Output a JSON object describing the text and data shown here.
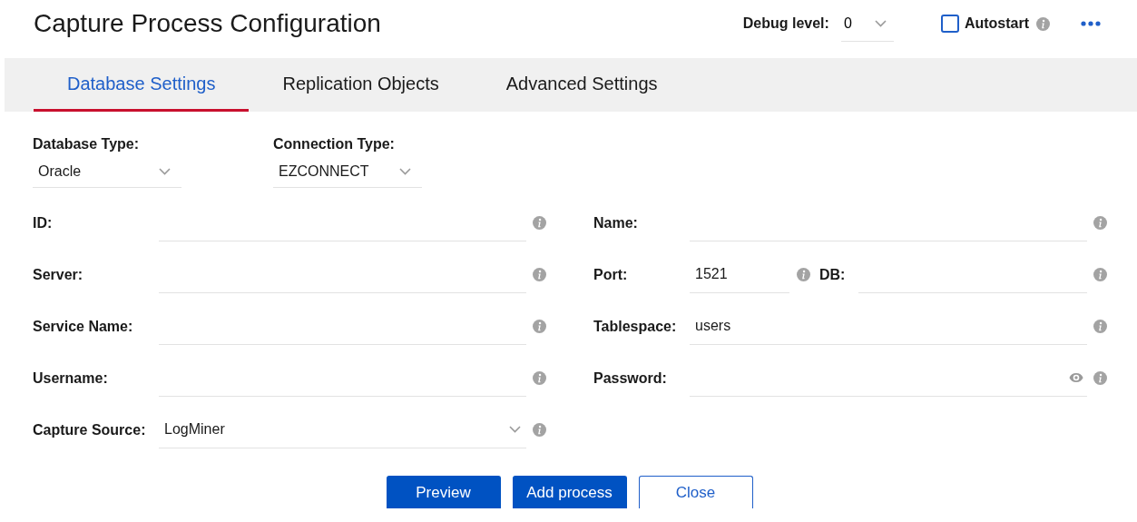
{
  "title": "Capture Process Configuration",
  "debug": {
    "label": "Debug level:",
    "value": "0"
  },
  "autostart": {
    "label": "Autostart",
    "checked": false
  },
  "tabs": [
    {
      "label": "Database Settings",
      "selected": true
    },
    {
      "label": "Replication Objects",
      "selected": false
    },
    {
      "label": "Advanced Settings",
      "selected": false
    }
  ],
  "selects": [
    {
      "label": "Database Type:",
      "value": "Oracle"
    },
    {
      "label": "Connection Type:",
      "value": "EZCONNECT"
    }
  ],
  "left_fields": [
    {
      "kind": "text",
      "label": "ID:"
    },
    {
      "kind": "text",
      "label": "Server:"
    },
    {
      "kind": "text",
      "label": "Service Name:"
    },
    {
      "kind": "text",
      "label": "Username:"
    },
    {
      "kind": "select",
      "label": "Capture Source:",
      "value": "LogMiner"
    }
  ],
  "right_fields": [
    {
      "kind": "text",
      "label": "Name:"
    },
    {
      "kind": "pair",
      "label": "Port:",
      "value": "1521",
      "second": {
        "label": "DB:"
      }
    },
    {
      "kind": "text",
      "label": "Tablespace:",
      "value": "users"
    },
    {
      "kind": "password",
      "label": "Password:"
    }
  ],
  "buttons": [
    {
      "label": "Preview",
      "kind": "primary"
    },
    {
      "label": "Add process",
      "kind": "primary"
    },
    {
      "label": "Close",
      "kind": "secondary"
    }
  ]
}
